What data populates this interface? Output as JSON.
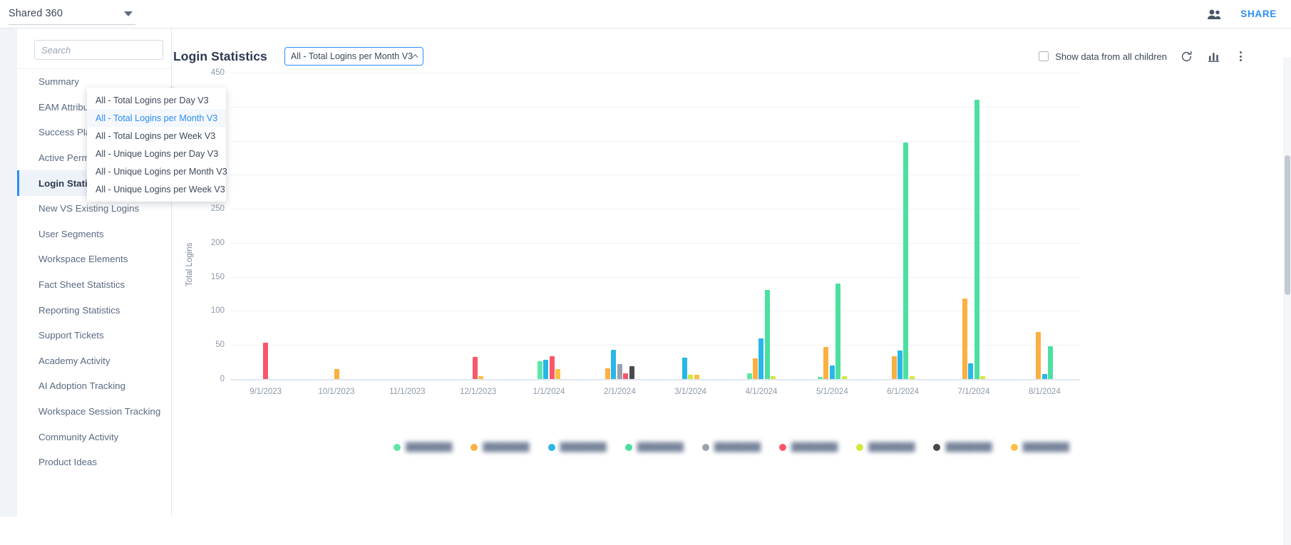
{
  "topbar": {
    "workspace": "Shared 360",
    "share_label": "SHARE",
    "people_icon": "people-icon",
    "caret_icon": "caret-down-icon"
  },
  "sidebar": {
    "search_placeholder": "Search",
    "items": [
      {
        "label": "Summary",
        "active": false
      },
      {
        "label": "EAM Attributes",
        "active": false
      },
      {
        "label": "Success Plans",
        "active": false
      },
      {
        "label": "Active Permissions",
        "active": false
      },
      {
        "label": "Login Statistics",
        "active": true
      },
      {
        "label": "New VS Existing Logins",
        "active": false
      },
      {
        "label": "User Segments",
        "active": false
      },
      {
        "label": "Workspace Elements",
        "active": false
      },
      {
        "label": "Fact Sheet Statistics",
        "active": false
      },
      {
        "label": "Reporting Statistics",
        "active": false
      },
      {
        "label": "Support Tickets",
        "active": false
      },
      {
        "label": "Academy Activity",
        "active": false
      },
      {
        "label": "AI Adoption Tracking",
        "active": false
      },
      {
        "label": "Workspace Session Tracking",
        "active": false
      },
      {
        "label": "Community Activity",
        "active": false
      },
      {
        "label": "Product Ideas",
        "active": false
      }
    ]
  },
  "header": {
    "title": "Login Statistics",
    "selected_view": "All - Total Logins per Month V3",
    "checkbox_label": "Show data from all children",
    "checkbox_checked": false,
    "refresh_icon": "refresh-icon",
    "chart_type_icon": "bar-chart-icon",
    "more_icon": "kebab-menu-icon"
  },
  "dropdown": {
    "open": true,
    "options": [
      {
        "label": "All - Total Logins per Day V3",
        "selected": false
      },
      {
        "label": "All - Total Logins per Month V3",
        "selected": true
      },
      {
        "label": "All - Total Logins per Week V3",
        "selected": false
      },
      {
        "label": "All - Unique Logins per Day V3",
        "selected": false
      },
      {
        "label": "All - Unique Logins per Month V3",
        "selected": false
      },
      {
        "label": "All - Unique Logins per Week V3",
        "selected": false
      }
    ]
  },
  "chart_data": {
    "type": "bar",
    "title": "Login Statistics",
    "xlabel": "",
    "ylabel": "Total Logins",
    "ylim": [
      0,
      450
    ],
    "yticks": [
      450,
      400,
      350,
      300,
      250,
      200,
      150,
      100,
      50,
      0
    ],
    "grid": true,
    "legend_position": "bottom",
    "categories": [
      "9/1/2023",
      "10/1/2023",
      "11/1/2023",
      "12/1/2023",
      "1/1/2024",
      "2/1/2024",
      "3/1/2024",
      "4/1/2024",
      "5/1/2024",
      "6/1/2024",
      "7/1/2024",
      "8/1/2024"
    ],
    "series": [
      {
        "name": "series-1",
        "color": "#5ee6a8",
        "label_redacted": true,
        "values": [
          0,
          0,
          0,
          0,
          26,
          0,
          0,
          8,
          3,
          0,
          0,
          0
        ]
      },
      {
        "name": "series-2",
        "color": "#fbb040",
        "label_redacted": true,
        "values": [
          0,
          15,
          0,
          0,
          0,
          16,
          0,
          30,
          47,
          34,
          118,
          69
        ]
      },
      {
        "name": "series-3",
        "color": "#29b6e8",
        "label_redacted": true,
        "values": [
          0,
          0,
          0,
          0,
          28,
          43,
          31,
          60,
          20,
          42,
          23,
          7
        ]
      },
      {
        "name": "series-4",
        "color": "#4be0a0",
        "label_redacted": true,
        "values": [
          0,
          0,
          0,
          0,
          0,
          0,
          0,
          131,
          140,
          347,
          410,
          48
        ]
      },
      {
        "name": "series-5",
        "color": "#9aa3ad",
        "label_redacted": true,
        "values": [
          0,
          0,
          0,
          0,
          0,
          22,
          0,
          0,
          0,
          0,
          0,
          0
        ]
      },
      {
        "name": "series-6",
        "color": "#f9566a",
        "label_redacted": true,
        "values": [
          53,
          0,
          0,
          32,
          33,
          8,
          0,
          0,
          0,
          0,
          0,
          0
        ]
      },
      {
        "name": "series-7",
        "color": "#d4e83a",
        "label_redacted": true,
        "values": [
          0,
          0,
          0,
          0,
          0,
          0,
          6,
          4,
          4,
          4,
          4,
          0
        ]
      },
      {
        "name": "series-8",
        "color": "#4a4a4a",
        "label_redacted": true,
        "values": [
          0,
          0,
          0,
          0,
          0,
          19,
          0,
          0,
          0,
          0,
          0,
          0
        ]
      },
      {
        "name": "series-9",
        "color": "#fcc045",
        "label_redacted": true,
        "values": [
          0,
          0,
          0,
          4,
          15,
          0,
          6,
          0,
          0,
          0,
          0,
          0
        ]
      }
    ]
  }
}
